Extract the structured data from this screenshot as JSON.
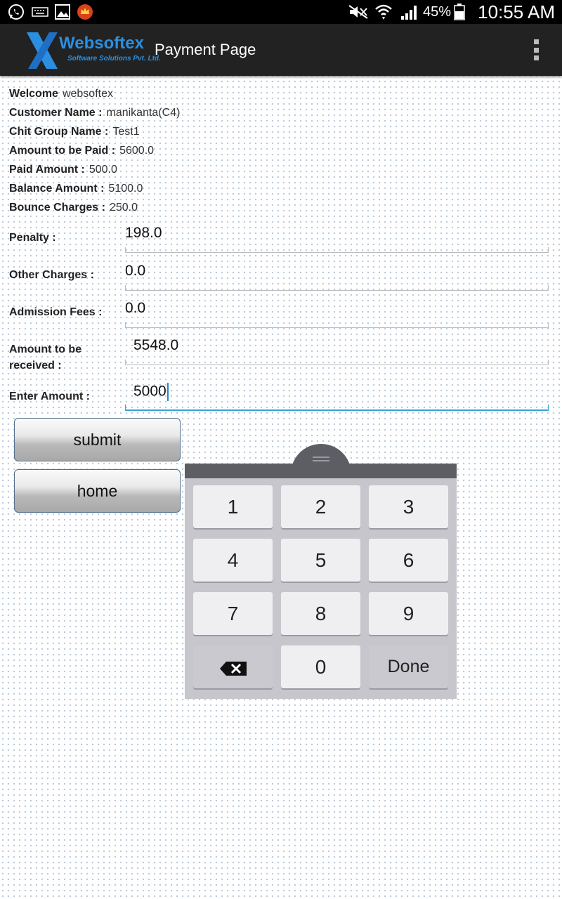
{
  "status_bar": {
    "battery_percent": "45%",
    "time": "10:55 AM",
    "icons": [
      "whatsapp-icon",
      "keyboard-icon",
      "image-icon",
      "app-crown-icon",
      "mute-icon",
      "wifi-icon",
      "signal-icon",
      "battery-icon"
    ]
  },
  "app_bar": {
    "logo_brand": "Websoftex",
    "logo_subtitle": "Software Solutions Pvt. Ltd.",
    "title": "Payment Page",
    "overflow_icon": "more-vert-icon"
  },
  "info": [
    {
      "label": "Welcome",
      "value": "websoftex"
    },
    {
      "label": "Customer Name :",
      "value": "manikanta(C4)"
    },
    {
      "label": "Chit Group Name :",
      "value": "Test1"
    },
    {
      "label": "Amount to be Paid :",
      "value": "5600.0"
    },
    {
      "label": "Paid Amount :",
      "value": "500.0"
    },
    {
      "label": "Balance Amount :",
      "value": "5100.0"
    },
    {
      "label": "Bounce Charges :",
      "value": "250.0"
    }
  ],
  "fields": [
    {
      "label": "Penalty :",
      "value": "198.0"
    },
    {
      "label": "Other Charges :",
      "value": "0.0"
    },
    {
      "label": "Admission Fees :",
      "value": "0.0"
    },
    {
      "label": "Amount to be received :",
      "value": "5548.0"
    },
    {
      "label": "Enter Amount :",
      "value": "5000"
    }
  ],
  "buttons": {
    "submit": "submit",
    "home": "home"
  },
  "keypad": {
    "keys": [
      "1",
      "2",
      "3",
      "4",
      "5",
      "6",
      "7",
      "8",
      "9",
      "0"
    ],
    "done": "Done",
    "delete_icon": "backspace-icon"
  }
}
